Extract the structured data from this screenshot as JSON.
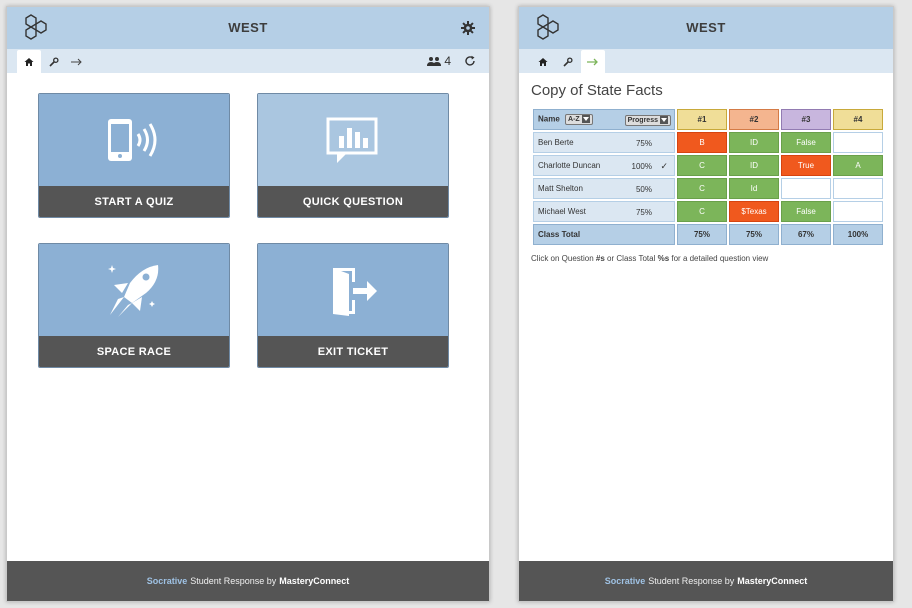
{
  "left": {
    "room": "WEST",
    "student_count": "4",
    "tiles": [
      {
        "label": "START A QUIZ",
        "icon": "phone-signal-icon"
      },
      {
        "label": "QUICK QUESTION",
        "icon": "chart-bubble-icon"
      },
      {
        "label": "SPACE RACE",
        "icon": "rocket-icon"
      },
      {
        "label": "EXIT TICKET",
        "icon": "exit-door-icon"
      }
    ]
  },
  "right": {
    "room": "WEST",
    "quiz_title": "Copy of State Facts",
    "table": {
      "name_header": "Name",
      "sort_label": "A-Z",
      "progress_label": "Progress",
      "questions": [
        "#1",
        "#2",
        "#3",
        "#4"
      ],
      "rows": [
        {
          "name": "Ben Berte",
          "progress": "75%",
          "check": "",
          "answers": [
            {
              "text": "B",
              "status": "red"
            },
            {
              "text": "ID",
              "status": "green"
            },
            {
              "text": "False",
              "status": "green"
            },
            {
              "text": "",
              "status": "empty"
            }
          ]
        },
        {
          "name": "Charlotte Duncan",
          "progress": "100%",
          "check": "✓",
          "answers": [
            {
              "text": "C",
              "status": "green"
            },
            {
              "text": "ID",
              "status": "green"
            },
            {
              "text": "True",
              "status": "red"
            },
            {
              "text": "A",
              "status": "green"
            }
          ]
        },
        {
          "name": "Matt Shelton",
          "progress": "50%",
          "check": "",
          "answers": [
            {
              "text": "C",
              "status": "green"
            },
            {
              "text": "Id",
              "status": "green"
            },
            {
              "text": "",
              "status": "empty"
            },
            {
              "text": "",
              "status": "empty"
            }
          ]
        },
        {
          "name": "Michael West",
          "progress": "75%",
          "check": "",
          "answers": [
            {
              "text": "C",
              "status": "green"
            },
            {
              "text": "$Texas",
              "status": "red"
            },
            {
              "text": "False",
              "status": "green"
            },
            {
              "text": "",
              "status": "empty"
            }
          ]
        }
      ],
      "total_label": "Class Total",
      "totals": [
        "75%",
        "75%",
        "67%",
        "100%"
      ]
    },
    "hint": {
      "part1": "Click on Question ",
      "bold1": "#s",
      "part2": " or Class Total ",
      "bold2": "%s",
      "part3": " for a detailed question view"
    }
  },
  "footer": {
    "brand": "Socrative",
    "middle": "Student Response by",
    "company": "MasteryConnect"
  },
  "colors": {
    "header": "#b5cfe6",
    "tile": "#8cb0d4",
    "correct": "#7cb55a",
    "incorrect": "#f0591e",
    "footer": "#555555"
  }
}
